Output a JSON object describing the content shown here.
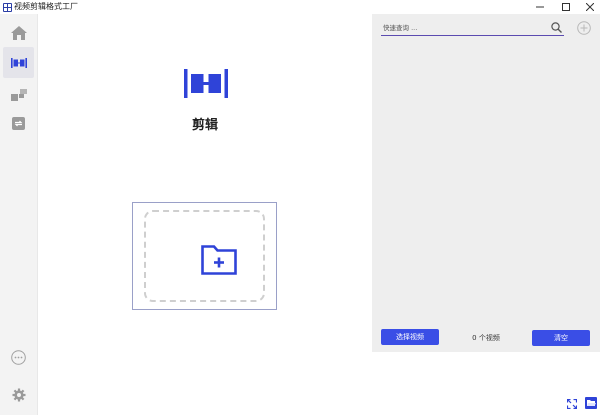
{
  "window": {
    "title": "视频剪辑格式工厂",
    "controls": [
      "minimize-icon",
      "maximize-icon",
      "close-icon"
    ]
  },
  "sidebar": {
    "items": [
      {
        "icon": "home-icon",
        "active": false
      },
      {
        "icon": "clip-icon",
        "active": true
      },
      {
        "icon": "merge-icon",
        "active": false
      },
      {
        "icon": "convert-icon",
        "active": false
      }
    ],
    "bottom_items": [
      {
        "icon": "more-icon"
      },
      {
        "icon": "settings-icon"
      }
    ]
  },
  "main": {
    "feature_label": "剪辑",
    "feature_icon": "clip-icon",
    "drop_zone_icon": "folder-add-icon"
  },
  "panel": {
    "search_placeholder": "快速查询 ...",
    "search_icon": "search-icon",
    "add_icon": "add-circle-icon",
    "select_button_label": "选择视频",
    "count_text": "0 个视频",
    "clear_button_label": "清空"
  },
  "footer_icons": [
    "fullscreen-icon",
    "open-folder-icon"
  ],
  "colors": {
    "accent": "#3a4ee6",
    "icon_blue": "#2f43d8",
    "sidebar_bg": "#f3f3f3",
    "panel_bg": "#eeeeee",
    "sidebar_icon": "#9a9a9a"
  }
}
